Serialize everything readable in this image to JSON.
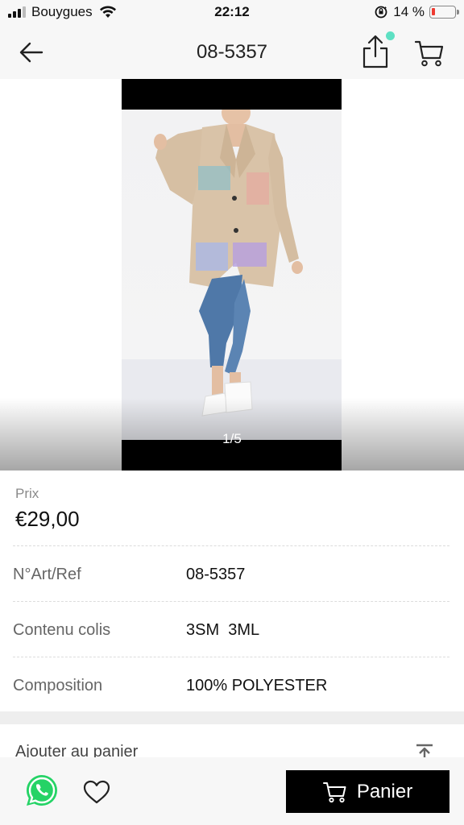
{
  "status_bar": {
    "carrier": "Bouygues",
    "time": "22:12",
    "battery_percent_text": "14 %",
    "battery_level": 0.14,
    "battery_color": "#ee3b31"
  },
  "nav": {
    "title": "08-5357",
    "back_icon": "arrow-left-icon",
    "share_icon": "share-icon",
    "cart_icon": "cart-icon",
    "notification_dot_color": "#5ee0c3"
  },
  "gallery": {
    "counter": "1/5",
    "image_description_icon": "product-photo"
  },
  "product": {
    "price_label": "Prix",
    "price_value": "€29,00",
    "rows": [
      {
        "label": "N°Art/Ref",
        "value": "08-5357"
      },
      {
        "label": "Contenu colis",
        "value": "3SM  3ML"
      },
      {
        "label": "Composition",
        "value": "100% POLYESTER"
      }
    ]
  },
  "add_to_cart": {
    "label": "Ajouter au panier",
    "icon": "scroll-to-top-icon"
  },
  "bottom_bar": {
    "whatsapp_icon": "whatsapp-icon",
    "favorite_icon": "heart-icon",
    "panier_label": "Panier",
    "whatsapp_color": "#25d366"
  }
}
